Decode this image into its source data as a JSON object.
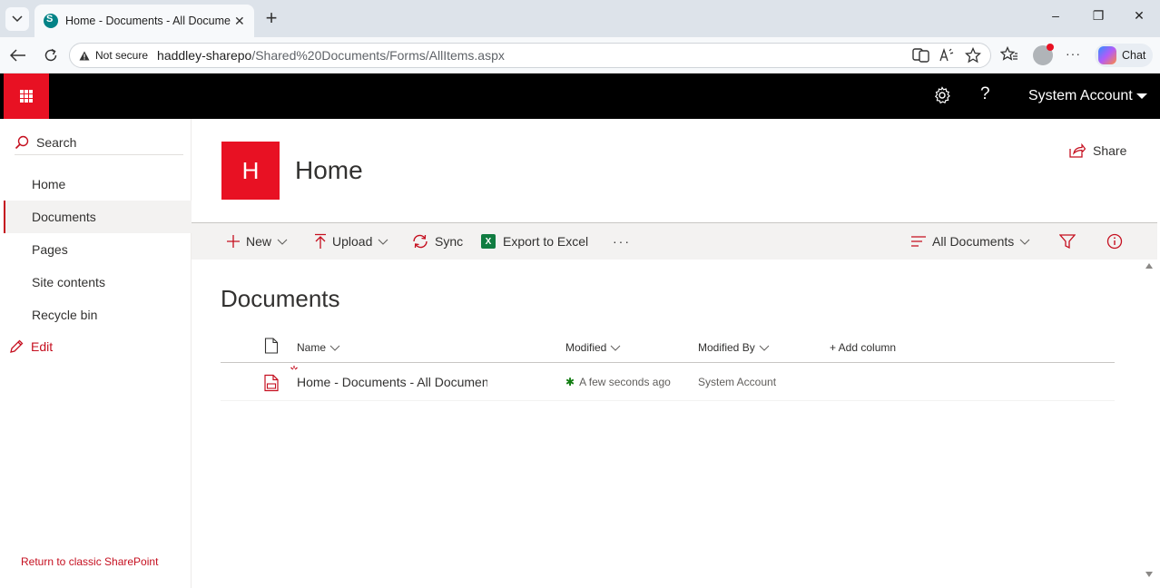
{
  "browser": {
    "tab_title": "Home - Documents - All Documents",
    "close_tab": "✕",
    "new_tab": "+",
    "url_warning": "Not secure",
    "url_host": "haddley-sharepo",
    "url_path": "/Shared%20Documents/Forms/AllItems.aspx",
    "chat_label": "Chat",
    "window_controls": [
      "–",
      "❐",
      "✕"
    ],
    "more": "···"
  },
  "suite": {
    "help": "?",
    "user_name": "System Account"
  },
  "leftnav": {
    "search_label": "Search",
    "items": [
      {
        "label": "Home",
        "active": false
      },
      {
        "label": "Documents",
        "active": true
      },
      {
        "label": "Pages",
        "active": false
      },
      {
        "label": "Site contents",
        "active": false
      },
      {
        "label": "Recycle bin",
        "active": false
      }
    ],
    "edit_label": "Edit",
    "classic_link": "Return to classic SharePoint"
  },
  "header": {
    "logo_letter": "H",
    "site_title": "Home",
    "share_label": "Share"
  },
  "commandbar": {
    "new_label": "New",
    "upload_label": "Upload",
    "sync_label": "Sync",
    "excel_label": "Export to Excel",
    "excel_icon_letter": "X",
    "more_label": "···",
    "view_label": "All Documents"
  },
  "library": {
    "title": "Documents",
    "columns": {
      "name": "Name",
      "modified": "Modified",
      "modified_by": "Modified By",
      "add_column": "+ Add column"
    },
    "rows": [
      {
        "name": "Home - Documents - All Documents",
        "modified": "A few seconds ago",
        "modified_by": "System Account",
        "is_new": true
      }
    ]
  },
  "colors": {
    "accent": "#e81123",
    "accent_dark": "#c50f1f",
    "suitebar": "#000000",
    "commandbar_bg": "#f3f2f1"
  }
}
